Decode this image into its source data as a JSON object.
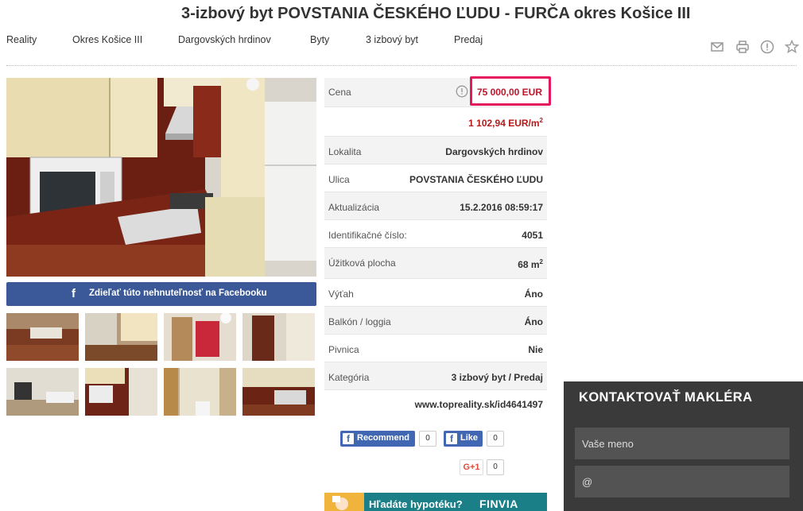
{
  "title": "3-izbový byt POVSTANIA ČESKÉHO ĽUDU - FURČA okres Košice III",
  "breadcrumb": [
    {
      "label": "Reality"
    },
    {
      "label": "Okres Košice III"
    },
    {
      "label": "Dargovských hrdinov"
    },
    {
      "label": "Byty"
    },
    {
      "label": "3 izbový byt"
    },
    {
      "label": "Predaj"
    }
  ],
  "tools": [
    "mail-icon",
    "print-icon",
    "alert-icon",
    "star-icon"
  ],
  "share": {
    "facebook_label": "Zdieľať túto nehnuteľnosť na Facebooku"
  },
  "price": {
    "label": "Cena",
    "value": "75 000,00 EUR",
    "per_m2": "1 102,94 EUR/m",
    "per_m2_sup": "2"
  },
  "details": [
    {
      "label": "Lokalita",
      "value": "Dargovských hrdinov"
    },
    {
      "label": "Ulica",
      "value": "POVSTANIA ČESKÉHO ĽUDU"
    },
    {
      "label": "Aktualizácia",
      "value": "15.2.2016 08:59:17"
    },
    {
      "label": "Identifikačné číslo:",
      "value": "4051"
    },
    {
      "label": "Úžitková plocha",
      "value": "68 m",
      "sup": "2"
    },
    {
      "label": "Výťah",
      "value": "Áno"
    },
    {
      "label": "Balkón / loggia",
      "value": "Áno"
    },
    {
      "label": "Pivnica",
      "value": "Nie"
    },
    {
      "label": "Kategória",
      "value": "3 izbový byt / Predaj"
    },
    {
      "label": "",
      "value": "www.topreality.sk/id4641497"
    }
  ],
  "social": {
    "recommend_label": "Recommend",
    "recommend_count": "0",
    "like_label": "Like",
    "like_count": "0",
    "gplus_label": "G+1",
    "gplus_count": "0"
  },
  "banner": {
    "question": "Hľadáte hypotéku?",
    "brand": "FINVIA"
  },
  "contact": {
    "title": "KONTAKTOVAŤ MAKLÉRA",
    "name_placeholder": "Vaše meno",
    "email_placeholder": "@"
  },
  "colors": {
    "price_border": "#e5175d",
    "price_text": "#c0152b",
    "facebook": "#3b5998",
    "contact_bg": "#3a3a3a"
  }
}
